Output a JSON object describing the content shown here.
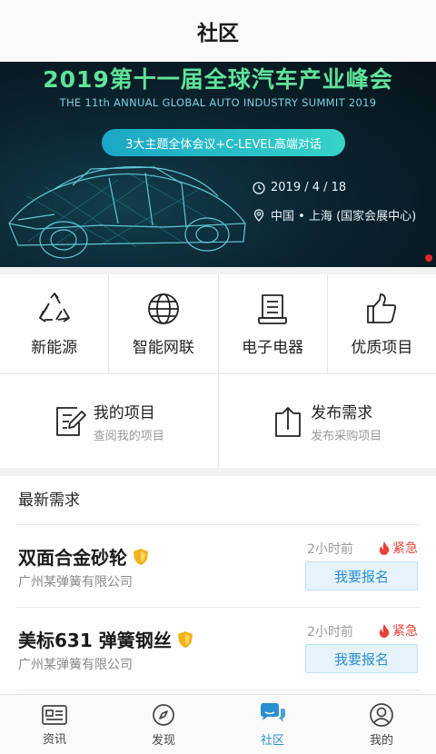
{
  "header": {
    "title": "社区"
  },
  "banner": {
    "title": "2019第十一届全球汽车产业峰会",
    "subtitle": "THE 11th ANNUAL GLOBAL AUTO INDUSTRY SUMMIT 2019",
    "pill": "3大主题全体会议+C-LEVEL高端对话",
    "date": "2019 / 4 / 18",
    "location": "中国 • 上海 (国家会展中心)",
    "colors": {
      "title": "#5fe39a",
      "pill": "#1aa6c6",
      "indicator": "#e8242a"
    }
  },
  "categories": [
    {
      "label": "新能源",
      "icon": "recycle-icon"
    },
    {
      "label": "智能网联",
      "icon": "globe-icon"
    },
    {
      "label": "电子电器",
      "icon": "document-icon"
    },
    {
      "label": "优质项目",
      "icon": "thumbs-up-icon"
    }
  ],
  "projects": {
    "mine": {
      "title": "我的项目",
      "desc": "查阅我的项目",
      "icon": "edit-icon"
    },
    "publish": {
      "title": "发布需求",
      "desc": "发布采购项目",
      "icon": "upload-icon"
    }
  },
  "needs": {
    "heading": "最新需求",
    "items": [
      {
        "name": "双面合金砂轮",
        "company": "广州某弹簧有限公司",
        "time": "2小时前",
        "urgent": "紧急",
        "button": "我要报名"
      },
      {
        "name": "美标631 弹簧钢丝",
        "company": "广州某弹簧有限公司",
        "time": "2小时前",
        "urgent": "紧急",
        "button": "我要报名"
      }
    ]
  },
  "tabs": [
    {
      "label": "资讯",
      "icon": "news-icon",
      "active": false
    },
    {
      "label": "发现",
      "icon": "compass-icon",
      "active": false
    },
    {
      "label": "社区",
      "icon": "chat-icon",
      "active": true
    },
    {
      "label": "我的",
      "icon": "user-icon",
      "active": false
    }
  ],
  "accent": "#2a8fd0"
}
